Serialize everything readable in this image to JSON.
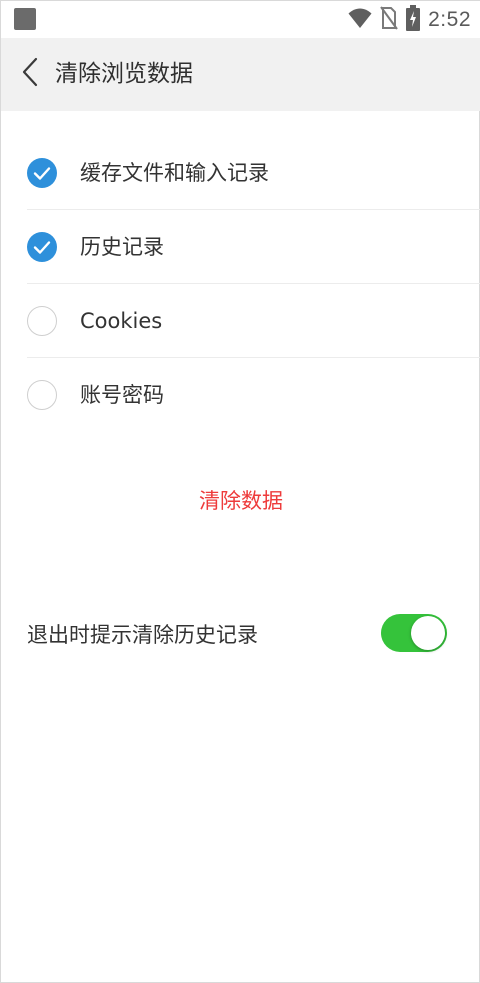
{
  "status_bar": {
    "time": "2:52",
    "icons": [
      "app-notification-icon",
      "wifi-icon",
      "no-sim-icon",
      "battery-charging-icon"
    ]
  },
  "header": {
    "back_icon": "chevron-left-icon",
    "title": "清除浏览数据"
  },
  "options": [
    {
      "label": "缓存文件和输入记录",
      "checked": true
    },
    {
      "label": "历史记录",
      "checked": true
    },
    {
      "label": "Cookies",
      "checked": false
    },
    {
      "label": "账号密码",
      "checked": false
    }
  ],
  "clear_button": {
    "label": "清除数据"
  },
  "exit_prompt": {
    "label": "退出时提示清除历史记录",
    "enabled": true
  },
  "colors": {
    "check_on": "#2e90db",
    "clear_text": "#ee3b3b",
    "toggle_on": "#35c33b",
    "header_bg": "#f1f1f1"
  }
}
